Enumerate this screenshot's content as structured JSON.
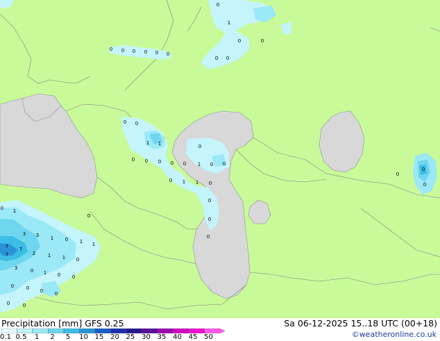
{
  "footer": {
    "title": "Precipitation [mm]  GFS 0.25",
    "valid_time": "Sa 06-12-2025 15..18 UTC (00+18)",
    "credit": "©weatheronline.co.uk"
  },
  "legend": {
    "ticks": [
      "0.1",
      "0.5",
      "1",
      "2",
      "5",
      "10",
      "15",
      "20",
      "25",
      "30",
      "35",
      "40",
      "45",
      "50"
    ],
    "colors": [
      "#e6fcff",
      "#c4f4fc",
      "#9be8f6",
      "#6ed6ee",
      "#3cbde6",
      "#2894d6",
      "#1a5ec8",
      "#1830b0",
      "#28168e",
      "#5c0ca0",
      "#9c08b4",
      "#d006c4",
      "#f010d4",
      "#ff58e8"
    ]
  },
  "map": {
    "land_color": "#c8fa9a",
    "sea_color": "#d8d8d8",
    "precip_values": [
      "0",
      "1",
      "0",
      "0",
      "0",
      "0",
      "0",
      "0",
      "0",
      "0",
      "0",
      "0",
      "0",
      "0",
      "1",
      "1",
      "0",
      "0",
      "0",
      "0",
      "0",
      "0",
      "1",
      "0",
      "0",
      "0",
      "1",
      "1",
      "0",
      "0",
      "0",
      "0",
      "0",
      "0",
      "0",
      "7",
      "0",
      "1",
      "3",
      "3",
      "1",
      "0",
      "1",
      "1",
      "7",
      "7",
      "2",
      "1",
      "1",
      "0",
      "3",
      "0",
      "1",
      "0",
      "0",
      "0",
      "0",
      "0",
      "0",
      "0",
      "0",
      "0"
    ]
  }
}
